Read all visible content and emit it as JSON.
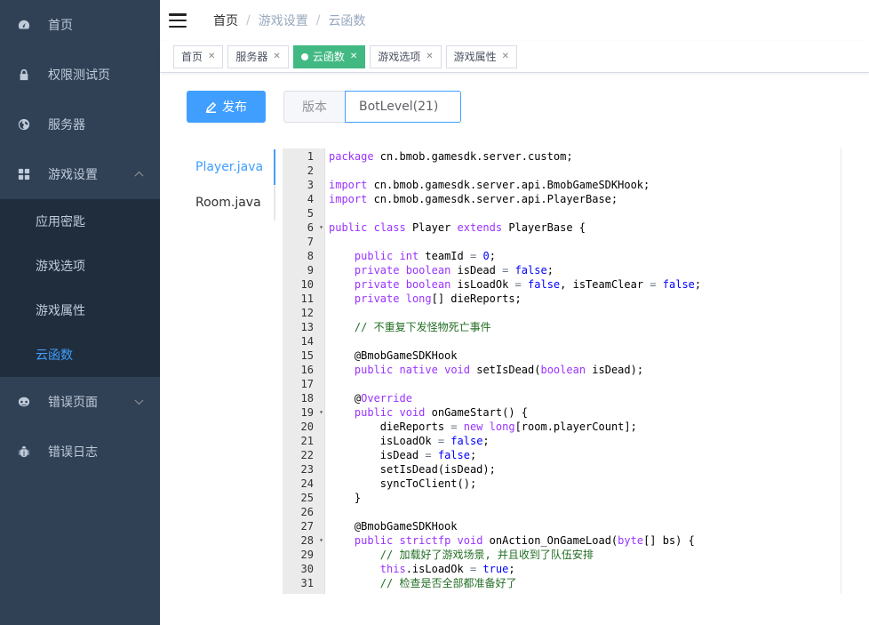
{
  "sidebar": {
    "items": [
      {
        "label": "首页",
        "icon": "dashboard-icon"
      },
      {
        "label": "权限测试页",
        "icon": "lock-icon"
      },
      {
        "label": "服务器",
        "icon": "globe-icon"
      },
      {
        "label": "游戏设置",
        "icon": "grid-icon",
        "expanded": true
      },
      {
        "label": "错误页面",
        "icon": "404-icon",
        "expanded": false
      },
      {
        "label": "错误日志",
        "icon": "bug-icon"
      }
    ],
    "submenu": [
      "应用密匙",
      "游戏选项",
      "游戏属性",
      "云函数"
    ],
    "active_sub": "云函数"
  },
  "header": {
    "breadcrumb": [
      "首页",
      "游戏设置",
      "云函数"
    ]
  },
  "tags": [
    {
      "label": "首页",
      "active": false
    },
    {
      "label": "服务器",
      "active": false
    },
    {
      "label": "云函数",
      "active": true
    },
    {
      "label": "游戏选项",
      "active": false
    },
    {
      "label": "游戏属性",
      "active": false
    }
  ],
  "toolbar": {
    "publish_label": "发布",
    "version_label": "版本",
    "version_value": "BotLevel(21)"
  },
  "files": [
    "Player.java",
    "Room.java"
  ],
  "active_file": "Player.java",
  "editor": {
    "lines": [
      "package cn.bmob.gamesdk.server.custom;",
      "",
      "import cn.bmob.gamesdk.server.api.BmobGameSDKHook;",
      "import cn.bmob.gamesdk.server.api.PlayerBase;",
      "",
      "public class Player extends PlayerBase {",
      "",
      "    public int teamId = 0;",
      "    private boolean isDead = false;",
      "    private boolean isLoadOk = false, isTeamClear = false;",
      "    private long[] dieReports;",
      "",
      "    // 不重复下发怪物死亡事件",
      "",
      "    @BmobGameSDKHook",
      "    public native void setIsDead(boolean isDead);",
      "",
      "    @Override",
      "    public void onGameStart() {",
      "        dieReports = new long[room.playerCount];",
      "        isLoadOk = false;",
      "        isDead = false;",
      "        setIsDead(isDead);",
      "        syncToClient();",
      "    }",
      "",
      "    @BmobGameSDKHook",
      "    public strictfp void onAction_OnGameLoad(byte[] bs) {",
      "        // 加载好了游戏场景, 并且收到了队伍安排",
      "        this.isLoadOk = true;",
      "        // 检查是否全部都准备好了"
    ],
    "fold_lines": [
      6,
      19,
      28
    ]
  },
  "colors": {
    "sidebar_bg": "#304156",
    "submenu_bg": "#1f2d3d",
    "accent": "#409eff",
    "active_tag": "#42b983"
  }
}
